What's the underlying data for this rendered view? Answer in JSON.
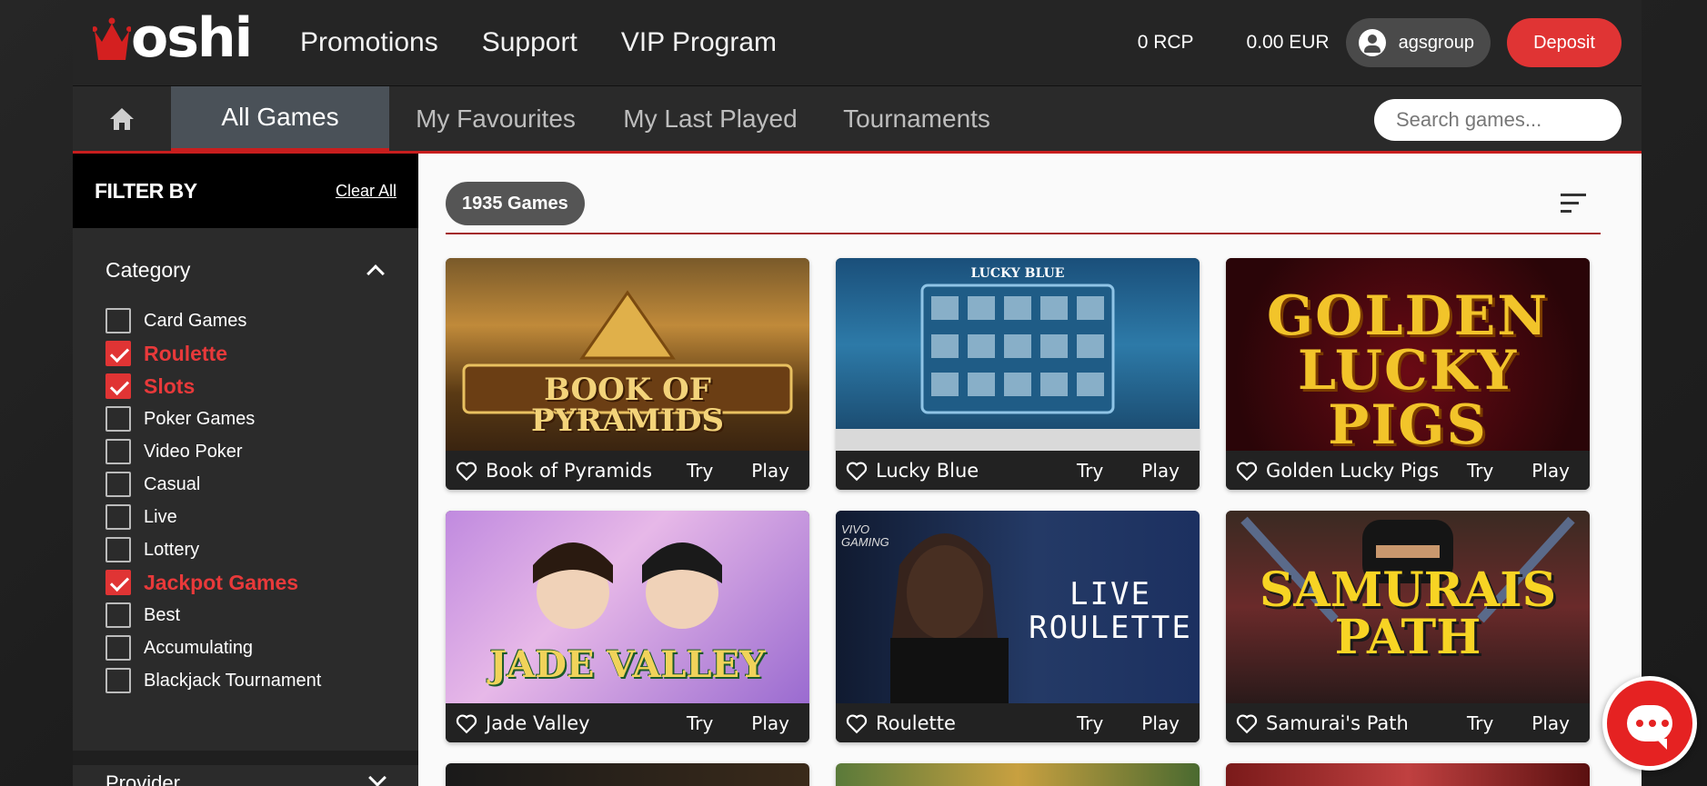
{
  "header": {
    "logo_text": "oshi",
    "nav": [
      "Promotions",
      "Support",
      "VIP Program"
    ],
    "rcp": "0 RCP",
    "balance": "0.00 EUR",
    "username": "agsgroup",
    "deposit_label": "Deposit"
  },
  "tabs": {
    "items": [
      "All Games",
      "My Favourites",
      "My Last Played",
      "Tournaments"
    ],
    "active": "All Games",
    "search_placeholder": "Search games..."
  },
  "sidebar": {
    "filter_title": "FILTER BY",
    "clear_all": "Clear All",
    "category_title": "Category",
    "categories": [
      {
        "label": "Card Games",
        "checked": false
      },
      {
        "label": "Roulette",
        "checked": true
      },
      {
        "label": "Slots",
        "checked": true
      },
      {
        "label": "Poker Games",
        "checked": false
      },
      {
        "label": "Video Poker",
        "checked": false
      },
      {
        "label": "Casual",
        "checked": false
      },
      {
        "label": "Live",
        "checked": false
      },
      {
        "label": "Lottery",
        "checked": false
      },
      {
        "label": "Jackpot Games",
        "checked": true
      },
      {
        "label": "Best",
        "checked": false
      },
      {
        "label": "Accumulating",
        "checked": false
      },
      {
        "label": "Blackjack Tournament",
        "checked": false
      }
    ],
    "provider_title": "Provider"
  },
  "main": {
    "games_count": "1935 Games",
    "games": [
      {
        "name": "Book of Pyramids",
        "art": "BOOK OF PYRAMIDS",
        "try": "Try",
        "play": "Play"
      },
      {
        "name": "Lucky Blue",
        "art": "LUCKY BLUE",
        "try": "Try",
        "play": "Play"
      },
      {
        "name": "Golden Lucky Pigs",
        "art": "GOLDEN LUCKY PIGS",
        "try": "Try",
        "play": "Play"
      },
      {
        "name": "Jade Valley",
        "art": "JADE VALLEY",
        "try": "Try",
        "play": "Play"
      },
      {
        "name": "Roulette",
        "art": "LIVE ROULETTE",
        "art_brand": "VIVO GAMING",
        "try": "Try",
        "play": "Play"
      },
      {
        "name": "Samurai's Path",
        "art": "SAMURAIS PATH",
        "try": "Try",
        "play": "Play"
      }
    ]
  },
  "colors": {
    "accent_red": "#e03434",
    "active_tab": "#4a5158",
    "topbar": "#252525",
    "sidebar": "#2b2b2b"
  },
  "icons": [
    "crown-icon",
    "home-icon",
    "user-icon",
    "sort-icon",
    "heart-icon",
    "chevron-up-icon",
    "chevron-down-icon",
    "chat-icon"
  ]
}
